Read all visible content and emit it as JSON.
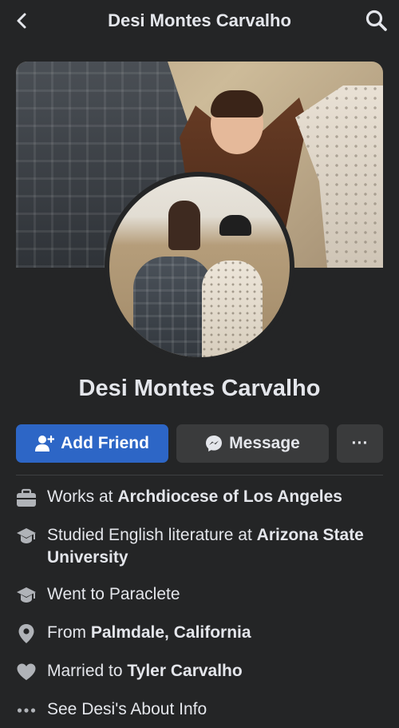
{
  "header": {
    "title": "Desi Montes Carvalho",
    "back_icon": "chevron-left-icon",
    "search_icon": "search-icon"
  },
  "profile": {
    "name": "Desi Montes Carvalho"
  },
  "actions": {
    "add_friend": "Add Friend",
    "message": "Message",
    "more": "···"
  },
  "about": {
    "work_prefix": "Works at",
    "work_place": "Archdiocese of Los Angeles",
    "study_prefix": "Studied English literature at",
    "study_place": "Arizona State University",
    "went_prefix": "Went to",
    "went_place": "Paraclete",
    "from_prefix": "From",
    "from_place": "Palmdale, California",
    "married_prefix": "Married to",
    "married_to": "Tyler Carvalho",
    "see_about": "See Desi's About Info"
  },
  "colors": {
    "background": "#242526",
    "primary_button": "#2d66c6",
    "secondary_button": "#3a3b3c",
    "text": "#e4e6eb"
  }
}
